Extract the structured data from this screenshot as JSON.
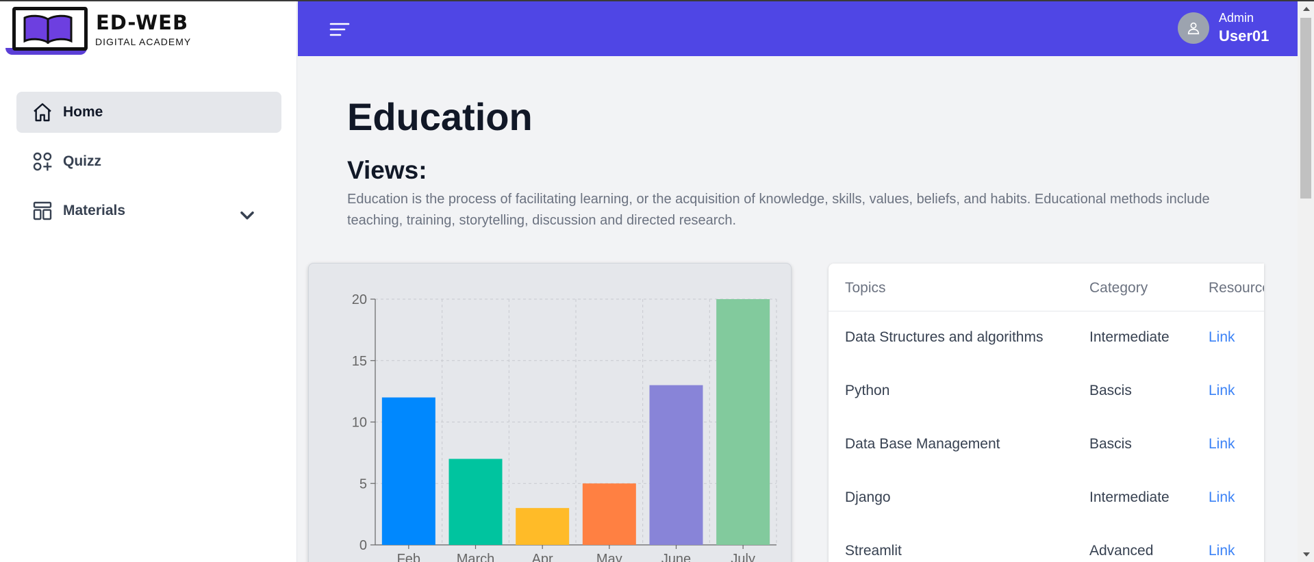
{
  "brand": {
    "title": "ED-WEB",
    "subtitle": "DIGITAL ACADEMY"
  },
  "sidebar": {
    "items": [
      {
        "label": "Home",
        "icon": "home-icon",
        "active": true
      },
      {
        "label": "Quizz",
        "icon": "apps-add-icon",
        "active": false
      },
      {
        "label": "Materials",
        "icon": "layout-icon",
        "active": false,
        "expandable": true
      }
    ]
  },
  "header": {
    "user_role": "Admin",
    "user_name": "User01",
    "accent": "#4f46e5"
  },
  "main": {
    "title": "Education",
    "section_title": "Views:",
    "description": "Education is the process of facilitating learning, or the acquisition of knowledge, skills, values, beliefs, and habits. Educational methods include teaching, training, storytelling, discussion and directed research."
  },
  "chart_data": {
    "type": "bar",
    "categories": [
      "Feb",
      "March",
      "Apr",
      "May",
      "June",
      "July"
    ],
    "values": [
      12,
      7,
      3,
      5,
      13,
      20
    ],
    "colors": [
      "#0088fe",
      "#00c49f",
      "#ffbb28",
      "#ff8042",
      "#8884d8",
      "#82ca9d"
    ],
    "ylim": [
      0,
      20
    ],
    "yticks": [
      0,
      5,
      10,
      15,
      20
    ],
    "grid": true
  },
  "table": {
    "headers": [
      "Topics",
      "Category",
      "Resource"
    ],
    "rows": [
      {
        "topic": "Data Structures and algorithms",
        "category": "Intermediate",
        "resource": "Link"
      },
      {
        "topic": "Python",
        "category": "Bascis",
        "resource": "Link"
      },
      {
        "topic": "Data Base Management",
        "category": "Bascis",
        "resource": "Link"
      },
      {
        "topic": "Django",
        "category": "Intermediate",
        "resource": "Link"
      },
      {
        "topic": "Streamlit",
        "category": "Advanced",
        "resource": "Link"
      }
    ]
  }
}
